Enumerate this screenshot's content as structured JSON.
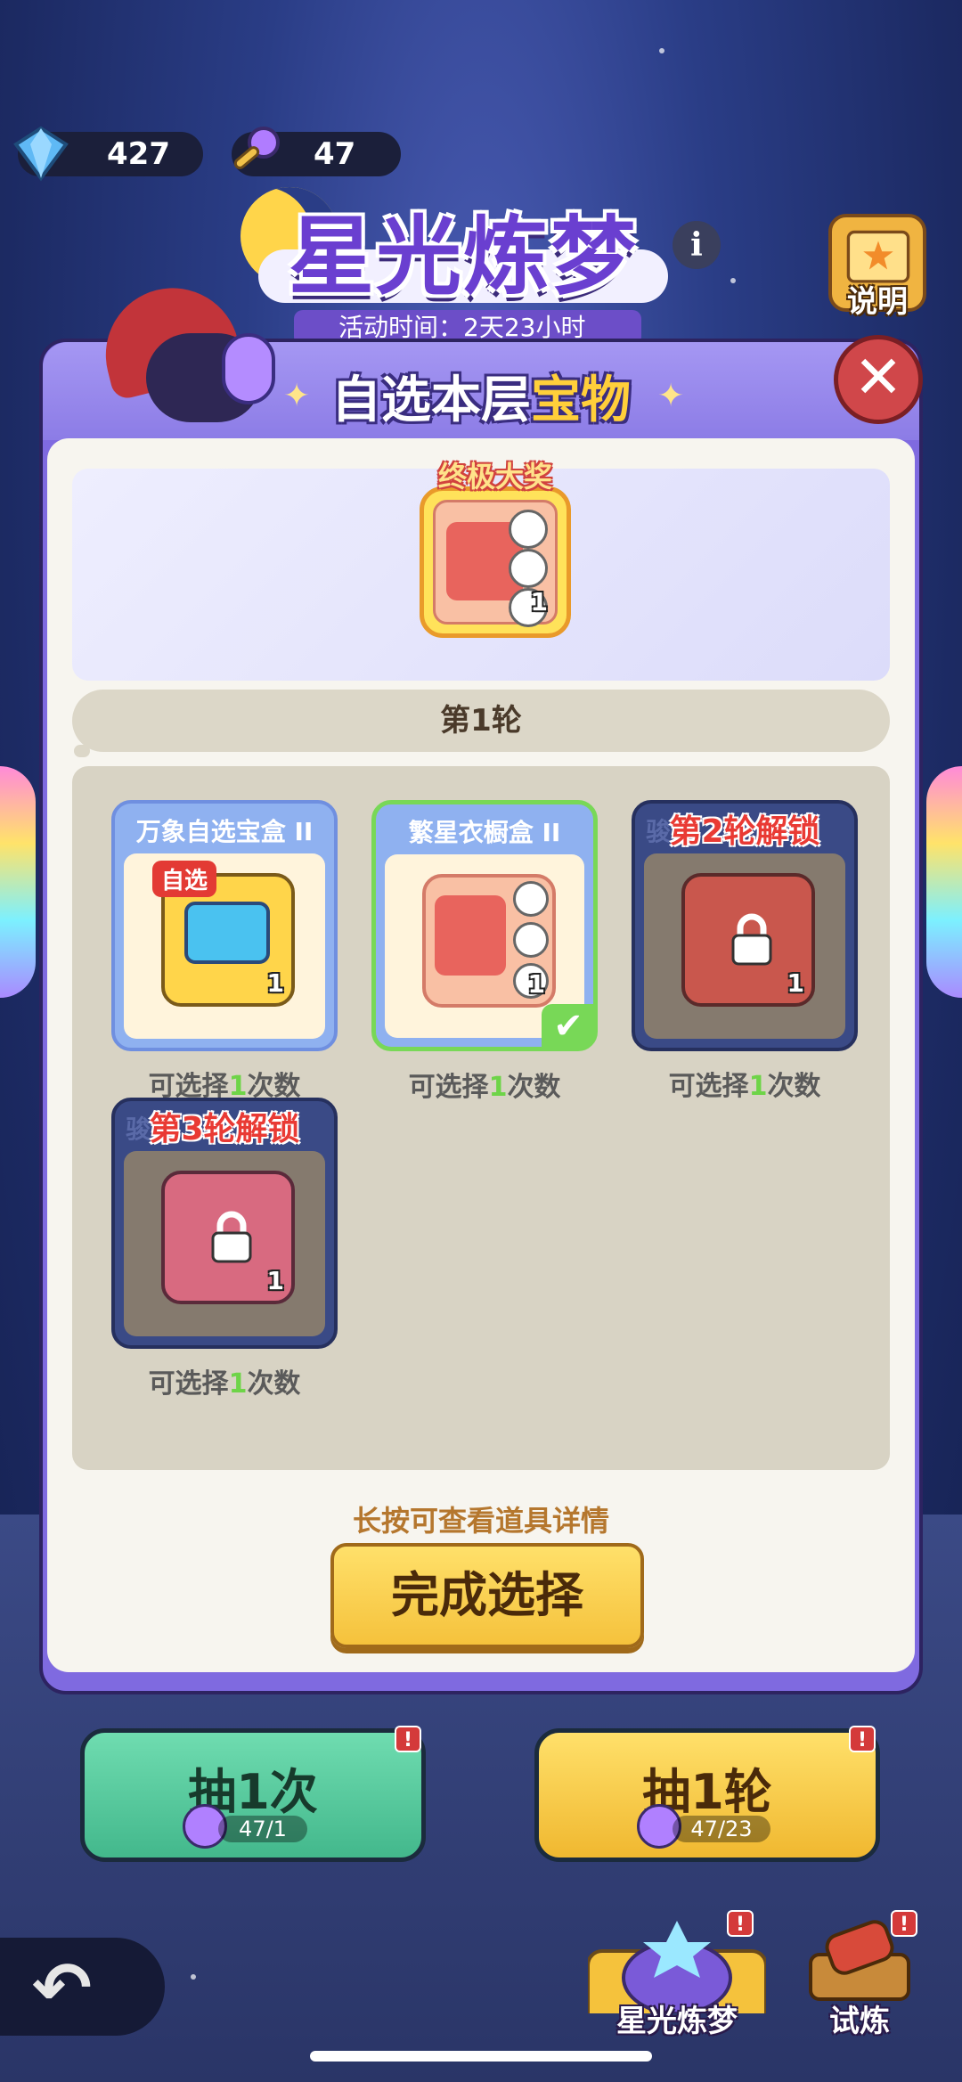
{
  "top": {
    "gems": "427",
    "keys": "47",
    "title": "星光炼梦",
    "info_icon": "i",
    "explain_label": "说明",
    "event_time": "活动时间：2天23小时"
  },
  "dialog": {
    "title_part1": "自选本层",
    "title_part2": "宝物",
    "close_icon": "close-icon",
    "grand_prize_tag": "终极大奖",
    "grand_prize_qty": "1",
    "round_label": "第1轮",
    "cards": [
      {
        "name": "万象自选宝盒 II",
        "tag": "自选",
        "qty": "1",
        "choose_prefix": "可选择",
        "choose_count": "1",
        "choose_suffix": "次数",
        "state": "available"
      },
      {
        "name": "繁星衣橱盒 II",
        "qty": "1",
        "choose_prefix": "可选择",
        "choose_count": "1",
        "choose_suffix": "次数",
        "state": "selected"
      },
      {
        "name": "骏",
        "lock_label": "第2轮解锁",
        "qty": "1",
        "choose_prefix": "可选择",
        "choose_count": "1",
        "choose_suffix": "次数",
        "state": "locked"
      },
      {
        "name": "骏",
        "lock_label": "第3轮解锁",
        "qty": "1",
        "choose_prefix": "可选择",
        "choose_count": "1",
        "choose_suffix": "次数",
        "state": "locked"
      }
    ],
    "hint": "长按可查看道具详情",
    "confirm_label": "完成选择"
  },
  "actions": {
    "draw_once": {
      "label": "抽1次",
      "cost": "47/1",
      "badge": "!"
    },
    "draw_round": {
      "label": "抽1轮",
      "cost": "47/23",
      "badge": "!"
    }
  },
  "nav": {
    "back_icon": "back-arrow-icon",
    "tab1": {
      "label": "星光炼梦",
      "badge": "!"
    },
    "tab2": {
      "label": "试炼",
      "badge": "!"
    }
  },
  "colors": {
    "primary_purple": "#7f6ae0",
    "green_button": "#4fc59a",
    "yellow_button": "#f5c23c",
    "lock_red": "#e93a34",
    "count_green": "#6ed448"
  }
}
